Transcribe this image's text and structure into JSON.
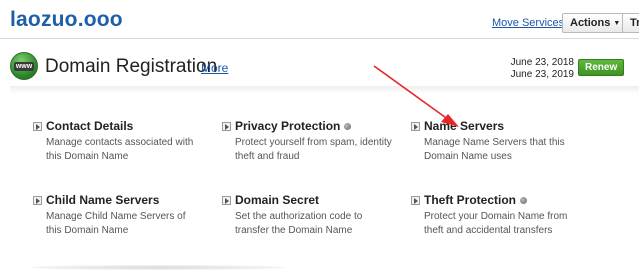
{
  "header": {
    "domain_name": "laozuo.ooo",
    "move_services": "Move Services",
    "actions": "Actions",
    "truncated_button": "Tr"
  },
  "section": {
    "icon_text": "www",
    "title": "Domain Registration",
    "more_link": "More",
    "date_registered": "June 23, 2018",
    "date_expires": "June 23, 2019",
    "renew": "Renew"
  },
  "items": [
    {
      "label": "Contact Details",
      "desc": "Manage contacts associated with this Domain Name",
      "has_dot": false
    },
    {
      "label": "Privacy Protection",
      "desc": "Protect yourself from spam, identity theft and fraud",
      "has_dot": true
    },
    {
      "label": "Name Servers",
      "desc": "Manage Name Servers that this Domain Name uses",
      "has_dot": false
    },
    {
      "label": "Child Name Servers",
      "desc": "Manage Child Name Servers of this Domain Name",
      "has_dot": false
    },
    {
      "label": "Domain Secret",
      "desc": "Set the authorization code to transfer the Domain Name",
      "has_dot": false
    },
    {
      "label": "Theft Protection",
      "desc": "Protect your Domain Name from theft and accidental transfers",
      "has_dot": true
    }
  ],
  "colors": {
    "link": "#1a57a7",
    "title": "#1f5fa8",
    "renew": "#4aa32b",
    "annotation_arrow": "#e8262a"
  }
}
